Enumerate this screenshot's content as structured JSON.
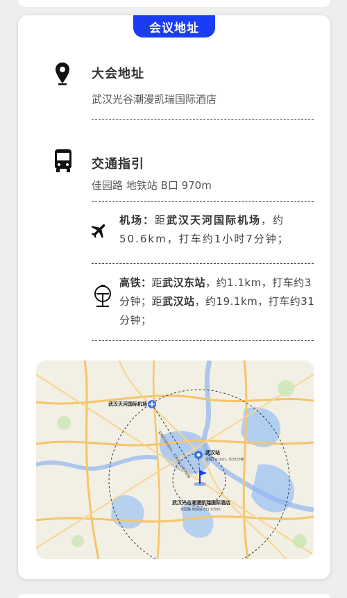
{
  "section": {
    "tab_label": "会议地址"
  },
  "venue": {
    "icon": "map-pin-icon",
    "title": "大会地址",
    "name": "武汉光谷潮漫凯瑞国际酒店"
  },
  "transport": {
    "icon": "bus-icon",
    "title": "交通指引",
    "metro": "佳园路 地铁站 B口 970m",
    "airport": {
      "icon": "airplane-icon",
      "label": "机场：",
      "prefix": "距",
      "place": "武汉天河国际机场",
      "detail": "，约50.6km，打车约1小时7分钟；"
    },
    "rail": {
      "icon": "train-station-icon",
      "label": "高铁：",
      "prefix1": "距",
      "place1": "武汉东站",
      "detail1": "，约1.1km，打车约3分钟；",
      "prefix2": "距",
      "place2": "武汉站",
      "detail2": "，约19.1km，打车约31分钟；"
    }
  },
  "map": {
    "airport_label": "武汉天河国际机场",
    "airport_route": "全程约50.6km，打车约1小时7分钟",
    "station_label": "武汉站",
    "station_route": "全程19.1km，约31分钟",
    "hotel_label": "武汉光谷潮漫凯瑞国际酒店",
    "hotel_sub": "佳园路 地铁站 B口 970m"
  },
  "colors": {
    "accent": "#1a3cf2",
    "map_pin": "#3b6fe0"
  }
}
